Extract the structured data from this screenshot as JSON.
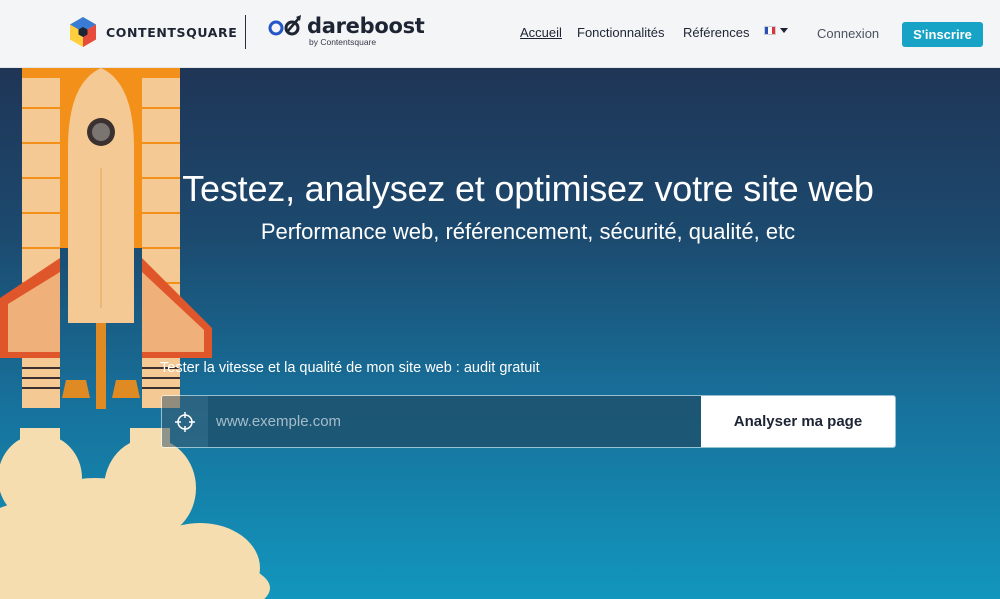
{
  "header": {
    "brand_contentsquare": "CONTENTSQUARE",
    "brand_dareboost": "dareboost",
    "brand_dareboost_sub": "by Contentsquare",
    "nav": [
      {
        "label": "Accueil",
        "active": true
      },
      {
        "label": "Fonctionnalités"
      },
      {
        "label": "Références"
      }
    ],
    "language": {
      "icon": "flag-fr-icon",
      "colors": [
        "#2b4fb8",
        "#ffffff",
        "#e0323c"
      ]
    },
    "login_label": "Connexion",
    "signup_label": "S'inscrire"
  },
  "hero": {
    "title": "Testez, analysez et optimisez votre site web",
    "subtitle": "Performance web, référencement, sécurité, qualité, etc",
    "form_label": "Tester la vitesse et la qualité de mon site web : audit gratuit",
    "url_placeholder": "www.exemple.com",
    "target_icon": "crosshair-icon",
    "submit_label": "Analyser ma page"
  },
  "colors": {
    "accent": "#16a3c6",
    "header_bg": "#f4f5f7",
    "hero_top": "#1f3556",
    "hero_bottom": "#1296bd",
    "rocket_orange": "#f39019",
    "rocket_body": "#f5c993"
  }
}
